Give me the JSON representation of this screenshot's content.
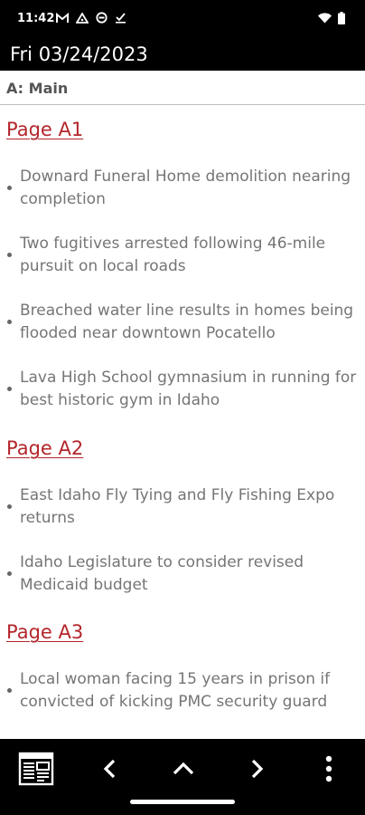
{
  "status_bar": {
    "time": "11:42",
    "icons": [
      "gmail-icon",
      "drive-icon",
      "settings-icon",
      "download-done-icon"
    ],
    "right_icons": [
      "wifi-icon",
      "battery-icon"
    ]
  },
  "header": {
    "date": "Fri 03/24/2023"
  },
  "section": {
    "label": "A: Main"
  },
  "pages": [
    {
      "heading": "Page A1",
      "articles": [
        "Downard Funeral Home demolition nearing completion",
        "Two fugitives arrested following 46-mile pursuit on local roads",
        "Breached water line results in homes being flooded near downtown Pocatello",
        "Lava High School gymnasium in running for best historic gym in Idaho"
      ]
    },
    {
      "heading": "Page A2",
      "articles": [
        "East Idaho Fly Tying and  Fly Fishing Expo returns",
        "Idaho Legislature to consider revised Medicaid budget"
      ]
    },
    {
      "heading": "Page A3",
      "articles": [
        "Local woman facing 15 years in prison if convicted of kicking PMC security guard"
      ]
    }
  ],
  "colors": {
    "accent": "#b3262b",
    "text": "#757575",
    "bar": "#000000"
  },
  "bottom_nav": {
    "buttons": [
      "newspaper-icon",
      "chevron-left-icon",
      "chevron-up-icon",
      "chevron-right-icon",
      "more-vert-icon"
    ]
  }
}
